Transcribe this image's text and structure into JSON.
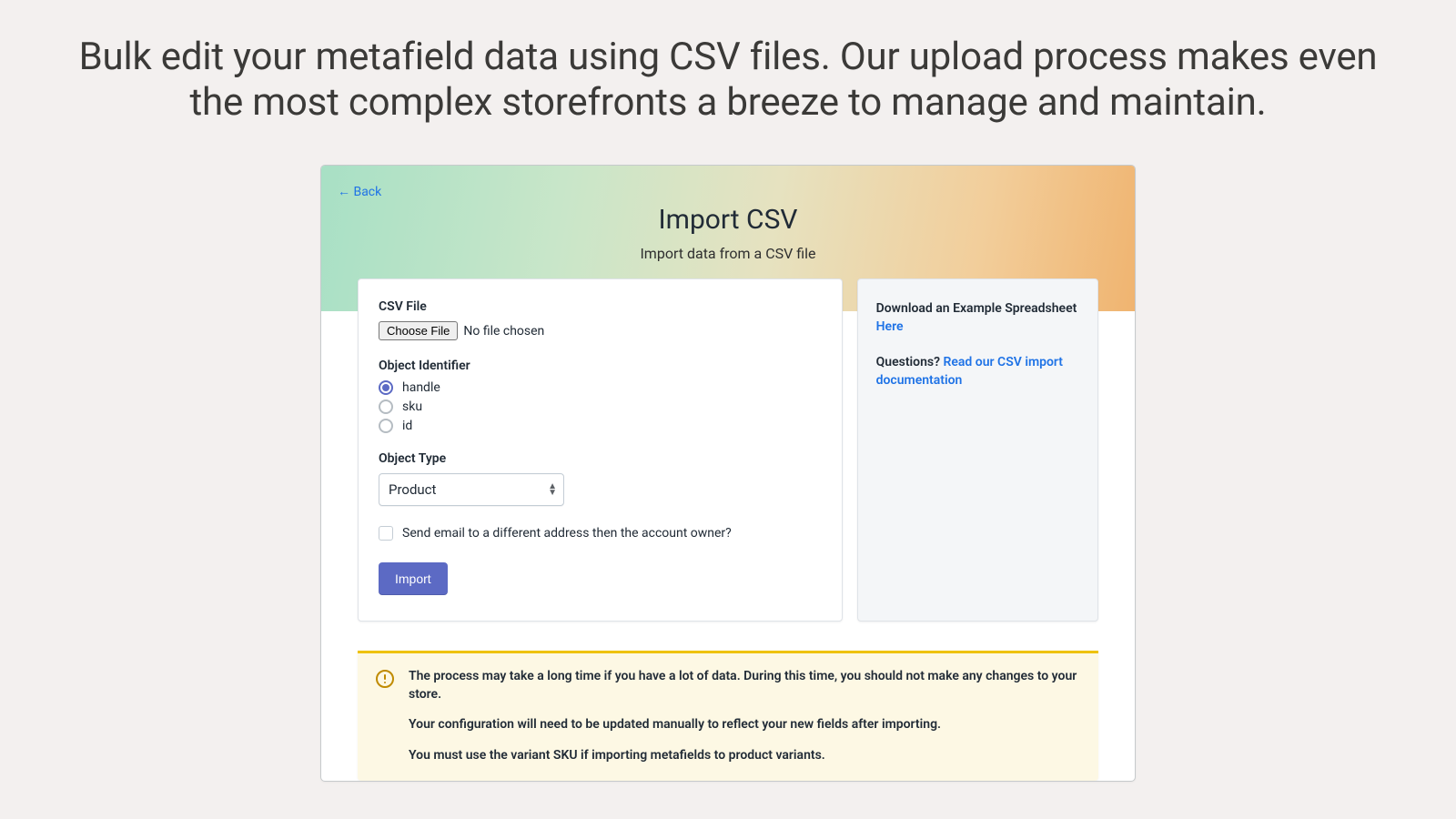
{
  "headline": "Bulk edit your metafield data using CSV files. Our upload process makes even the most complex storefronts a breeze to manage and maintain.",
  "header": {
    "back_label": "← Back",
    "title": "Import CSV",
    "subtitle": "Import data from a CSV file"
  },
  "form": {
    "csv_label": "CSV File",
    "choose_file_label": "Choose File",
    "file_status": "No file chosen",
    "identifier_label": "Object Identifier",
    "identifiers": {
      "handle": "handle",
      "sku": "sku",
      "id": "id"
    },
    "object_type_label": "Object Type",
    "object_type_value": "Product",
    "email_checkbox_label": "Send email to a different address then the account owner?",
    "import_button": "Import"
  },
  "sidebar": {
    "download_prefix": "Download an Example Spreadsheet ",
    "download_link": "Here",
    "questions_prefix": "Questions? ",
    "questions_link": "Read our CSV import documentation"
  },
  "warning": {
    "line1": "The process may take a long time if you have a lot of data. During this time, you should not make any changes to your store.",
    "line2": "Your configuration will need to be updated manually to reflect your new fields after importing.",
    "line3": "You must use the variant SKU if importing metafields to product variants."
  }
}
